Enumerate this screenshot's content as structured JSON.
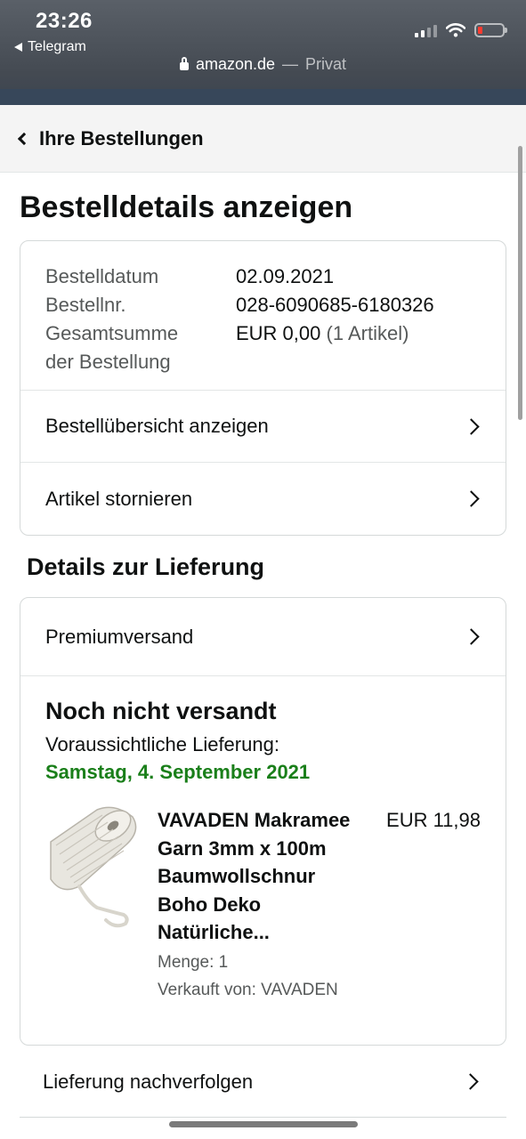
{
  "status_bar": {
    "time": "23:26",
    "back_app": "Telegram",
    "url_host": "amazon.de",
    "url_separator": "—",
    "url_mode": "Privat"
  },
  "breadcrumb": {
    "label": "Ihre Bestellungen"
  },
  "page_title": "Bestelldetails anzeigen",
  "order": {
    "date_label": "Bestelldatum",
    "date_value": "02.09.2021",
    "number_label": "Bestellnr.",
    "number_value": "028-6090685-6180326",
    "total_label_1": "Gesamtsumme",
    "total_label_2": "der Bestellung",
    "total_value": "EUR 0,00",
    "total_items": "(1 Artikel)"
  },
  "actions": {
    "overview": "Bestellübersicht anzeigen",
    "cancel": "Artikel stornieren"
  },
  "delivery": {
    "section_title": "Details zur Lieferung",
    "shipping_method": "Premiumversand",
    "status": "Noch nicht versandt",
    "estimate_label": "Voraussichtliche Lieferung:",
    "estimate_date": "Samstag, 4. September 2021",
    "colors": {
      "date": "#1a7f1a"
    }
  },
  "item": {
    "title_lines": [
      "VAVADEN Makramee",
      "Garn 3mm x 100m",
      "Baumwollschnur",
      "Boho Deko",
      "Natürliche..."
    ],
    "price": "EUR 11,98",
    "quantity": "Menge: 1",
    "seller": "Verkauft von: VAVADEN"
  },
  "track": {
    "label": "Lieferung nachverfolgen"
  }
}
